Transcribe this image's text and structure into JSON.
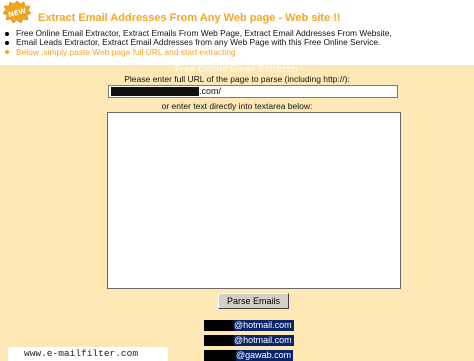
{
  "header": {
    "badge_text": "NEW",
    "title": "Extract Email Addresses From Any Web page - Web site !!"
  },
  "bullets": [
    "Free Online Email Extractor, Extract Emails From Web Page, Extract Email Addresses From Website,",
    "Email Leads Extractor, Extract Email Addresses from any Web Page with this Free Online Service.",
    "Below ,simply paste Web page full URL and start extracting"
  ],
  "form": {
    "heading": "Free Online Email Extractor",
    "url_label": "Please enter full URL of the page to parse (including http://):",
    "url_value_suffix": ".com/",
    "textarea_label": "or enter text directly into textarea below:",
    "textarea_value": "",
    "submit_label": "Parse Emails"
  },
  "results": [
    {
      "domain": "@hotmail.com"
    },
    {
      "domain": "@hotmail.com"
    },
    {
      "domain": "@gawab.com"
    }
  ],
  "footer": {
    "site": "www.e-mailfilter.com"
  },
  "colors": {
    "accent": "#f5a623",
    "panel": "#fde8b6",
    "selection": "#0a246a"
  }
}
